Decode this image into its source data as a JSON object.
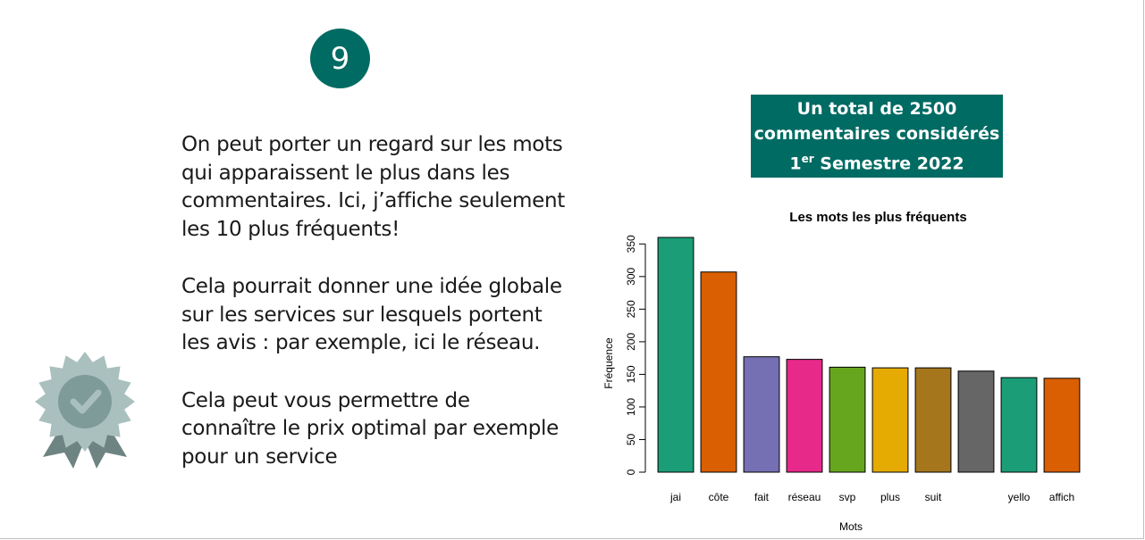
{
  "slide": {
    "number": "9",
    "paragraphs": [
      "On peut porter un regard sur les mots qui apparaissent le plus dans les commentaires. Ici, j’affiche seulement les 10 plus fréquents!",
      "Cela pourrait donner une idée globale sur les services sur lesquels portent les avis : par exemple, ici le réseau.",
      "Cela peut vous permettre de connaître le prix optimal par exemple pour un service"
    ],
    "total_box": {
      "line1": "Un total de 2500",
      "line2": "commentaires considérés",
      "line3_prefix": "1",
      "line3_sup": "er",
      "line3_suffix": " Semestre 2022"
    },
    "medal_icon": "award-ribbon-check-icon",
    "accent_color": "#006b63"
  },
  "chart_data": {
    "type": "bar",
    "title": "Les mots les plus fréquents",
    "xlabel": "Mots",
    "ylabel": "Fréquence",
    "categories": [
      "jai",
      "côte",
      "fait",
      "réseau",
      "svp",
      "plus",
      "suit",
      "",
      "yello",
      "affich"
    ],
    "values": [
      360,
      307,
      177,
      173,
      161,
      160,
      160,
      155,
      145,
      144
    ],
    "ylim": [
      0,
      350
    ],
    "yticks": [
      0,
      50,
      100,
      150,
      200,
      250,
      300,
      350
    ],
    "colors": [
      "#1b9e77",
      "#d95f02",
      "#7570b3",
      "#e7298a",
      "#66a61e",
      "#e6ab02",
      "#a6761d",
      "#666666",
      "#1b9e77",
      "#d95f02"
    ],
    "grid": false
  }
}
